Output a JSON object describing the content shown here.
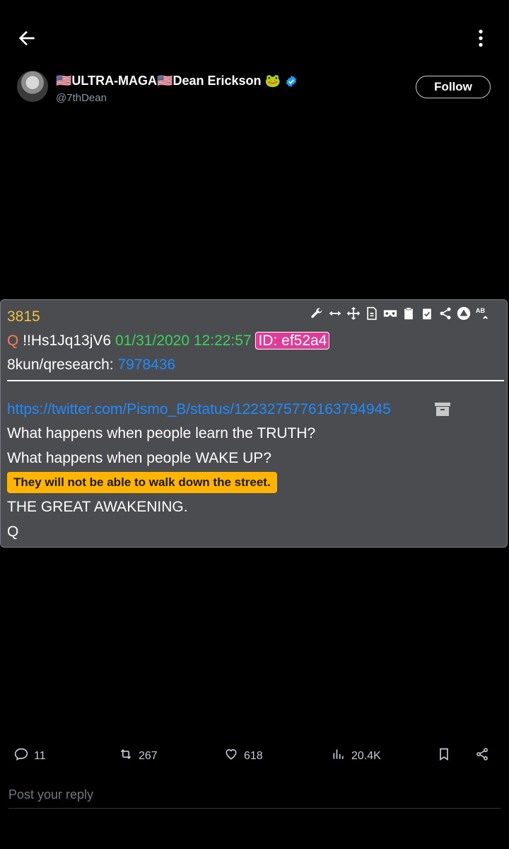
{
  "author": {
    "display_name": "🇺🇸ULTRA-MAGA🇺🇸Dean Erickson 🐸",
    "handle": "@7thDean",
    "follow_label": "Follow"
  },
  "board": {
    "post_number": "3815",
    "q_letter": "Q",
    "tripcode": "!!Hs1Jq13jV6",
    "datetime": "01/31/2020 12:22:57",
    "id_label": "ID: ef52a4",
    "board_name": "8kun/qresearch:",
    "reply_link": "7978436",
    "twitter_link": "https://twitter.com/Pismo_B/status/1223275776163794945",
    "line1": "What happens when people learn the TRUTH?",
    "line2": "What happens when people WAKE UP?",
    "highlight": "They will not be able to walk down the street.",
    "line3": "THE GREAT AWAKENING.",
    "signature": "Q"
  },
  "actions": {
    "replies": "11",
    "reposts": "267",
    "likes": "618",
    "views": "20.4K"
  },
  "reply": {
    "placeholder": "Post your reply"
  },
  "colors": {
    "accent_blue": "#1d9bf0",
    "board_bg": "#4b4c50",
    "highlight": "#ffb400"
  }
}
